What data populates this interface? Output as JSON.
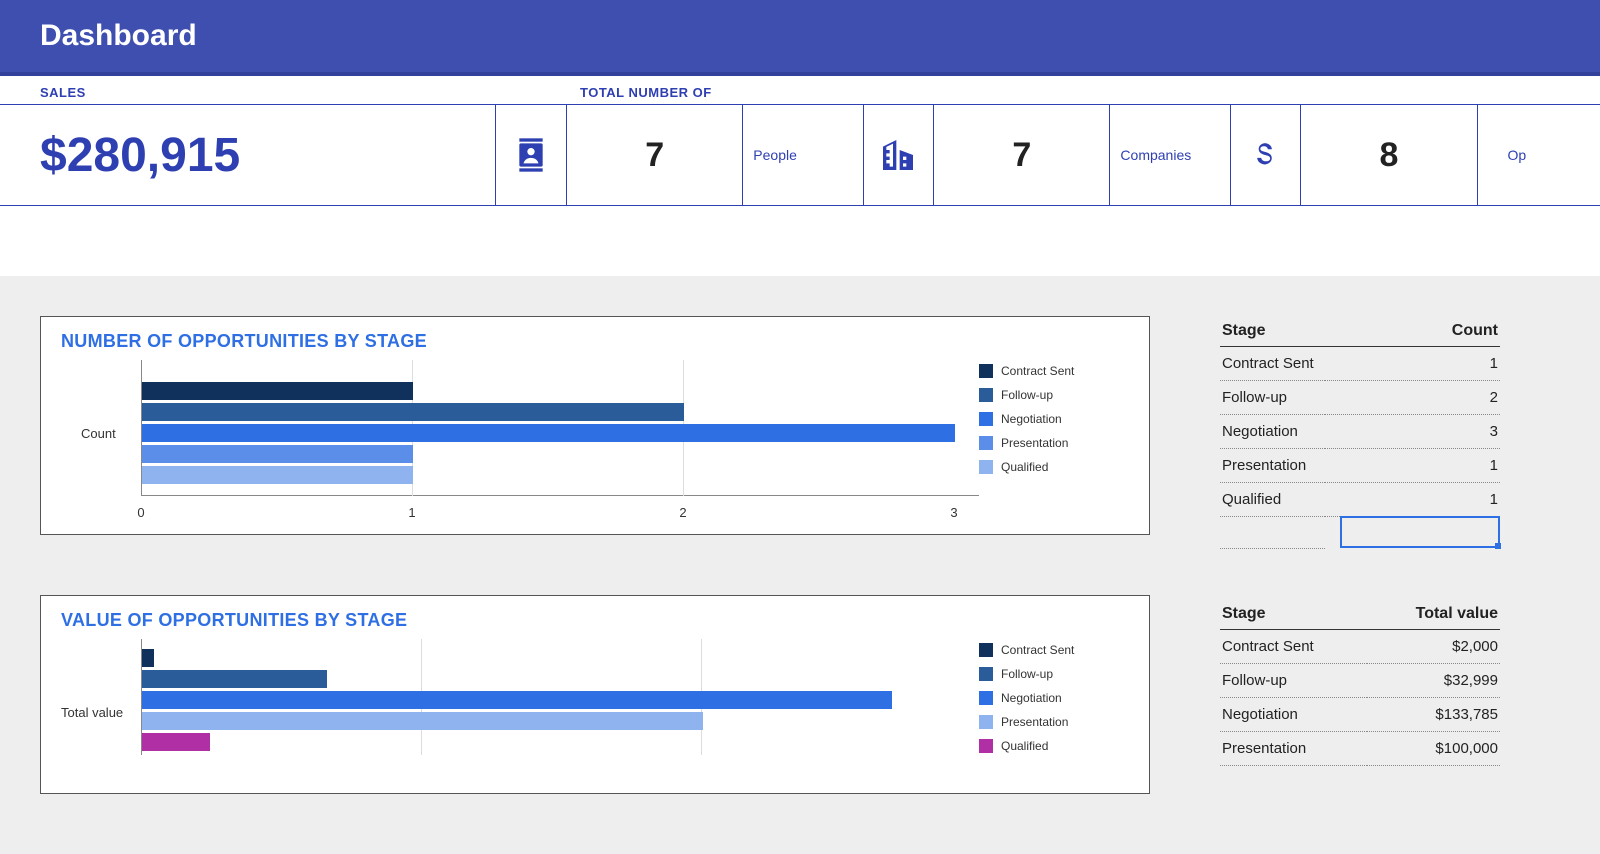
{
  "header": {
    "title": "Dashboard"
  },
  "stats": {
    "sales_label": "SALES",
    "total_label": "TOTAL NUMBER OF",
    "sales_value": "$280,915",
    "cards": [
      {
        "icon": "person",
        "value": "7",
        "label": "People"
      },
      {
        "icon": "building",
        "value": "7",
        "label": "Companies"
      },
      {
        "icon": "dollar",
        "value": "8",
        "label": "Op"
      }
    ]
  },
  "chart1": {
    "title": "NUMBER OF OPPORTUNITIES BY STAGE",
    "ylabel": "Count",
    "ticks": [
      "0",
      "1",
      "2",
      "3"
    ],
    "legend": [
      "Contract Sent",
      "Follow-up",
      "Negotiation",
      "Presentation",
      "Qualified"
    ]
  },
  "chart2": {
    "title": "VALUE OF OPPORTUNITIES BY STAGE",
    "ylabel": "Total value",
    "legend": [
      "Contract Sent",
      "Follow-up",
      "Negotiation",
      "Presentation",
      "Qualified"
    ]
  },
  "table1": {
    "headers": [
      "Stage",
      "Count"
    ],
    "rows": [
      [
        "Contract Sent",
        "1"
      ],
      [
        "Follow-up",
        "2"
      ],
      [
        "Negotiation",
        "3"
      ],
      [
        "Presentation",
        "1"
      ],
      [
        "Qualified",
        "1"
      ]
    ]
  },
  "table2": {
    "headers": [
      "Stage",
      "Total value"
    ],
    "rows": [
      [
        "Contract Sent",
        "$2,000"
      ],
      [
        "Follow-up",
        "$32,999"
      ],
      [
        "Negotiation",
        "$133,785"
      ],
      [
        "Presentation",
        "$100,000"
      ]
    ]
  },
  "chart_data": [
    {
      "type": "bar",
      "orientation": "horizontal",
      "title": "NUMBER OF OPPORTUNITIES BY STAGE",
      "xlabel": "",
      "ylabel": "Count",
      "xlim": [
        0,
        3
      ],
      "categories": [
        "Contract Sent",
        "Follow-up",
        "Negotiation",
        "Presentation",
        "Qualified"
      ],
      "values": [
        1,
        2,
        3,
        1,
        1
      ],
      "colors": [
        "#10315b",
        "#2a5c9a",
        "#2f6fe4",
        "#5a8ee8",
        "#8fb3ef"
      ]
    },
    {
      "type": "bar",
      "orientation": "horizontal",
      "title": "VALUE OF OPPORTUNITIES BY STAGE",
      "xlabel": "",
      "ylabel": "Total value",
      "categories": [
        "Contract Sent",
        "Follow-up",
        "Negotiation",
        "Presentation",
        "Qualified"
      ],
      "values": [
        2000,
        32999,
        133785,
        100000,
        12131
      ],
      "colors": [
        "#10315b",
        "#2a5c9a",
        "#2f6fe4",
        "#8fb3ef",
        "#b02fa4"
      ]
    }
  ]
}
